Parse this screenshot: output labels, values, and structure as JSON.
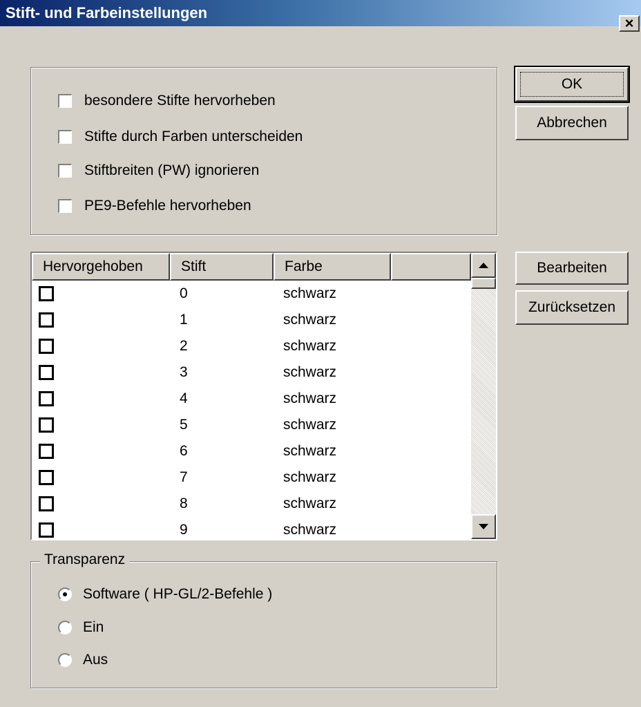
{
  "window": {
    "title": "Stift- und Farbeinstellungen",
    "close_glyph": "×"
  },
  "options": [
    {
      "label": "besondere Stifte hervorheben",
      "checked": false
    },
    {
      "label": "Stifte durch Farben unterscheiden",
      "checked": false
    },
    {
      "label": "Stiftbreiten (PW) ignorieren",
      "checked": false
    },
    {
      "label": "PE9-Befehle hervorheben",
      "checked": false
    }
  ],
  "buttons": {
    "ok": "OK",
    "cancel": "Abbrechen",
    "edit": "Bearbeiten",
    "reset": "Zurücksetzen"
  },
  "pen_table": {
    "columns": [
      "Hervorgehoben",
      "Stift",
      "Farbe"
    ],
    "rows": [
      {
        "highlighted": false,
        "pen": "0",
        "color": "schwarz"
      },
      {
        "highlighted": false,
        "pen": "1",
        "color": "schwarz"
      },
      {
        "highlighted": false,
        "pen": "2",
        "color": "schwarz"
      },
      {
        "highlighted": false,
        "pen": "3",
        "color": "schwarz"
      },
      {
        "highlighted": false,
        "pen": "4",
        "color": "schwarz"
      },
      {
        "highlighted": false,
        "pen": "5",
        "color": "schwarz"
      },
      {
        "highlighted": false,
        "pen": "6",
        "color": "schwarz"
      },
      {
        "highlighted": false,
        "pen": "7",
        "color": "schwarz"
      },
      {
        "highlighted": false,
        "pen": "8",
        "color": "schwarz"
      },
      {
        "highlighted": false,
        "pen": "9",
        "color": "schwarz"
      }
    ]
  },
  "transparency": {
    "legend": "Transparenz",
    "options": [
      {
        "label": "Software ( HP-GL/2-Befehle )",
        "selected": true
      },
      {
        "label": "Ein",
        "selected": false
      },
      {
        "label": "Aus",
        "selected": false
      }
    ]
  },
  "colors": {
    "dialog_bg": "#d4d0c8",
    "title_gradient_start": "#0a246a",
    "title_gradient_end": "#a6caf0"
  }
}
